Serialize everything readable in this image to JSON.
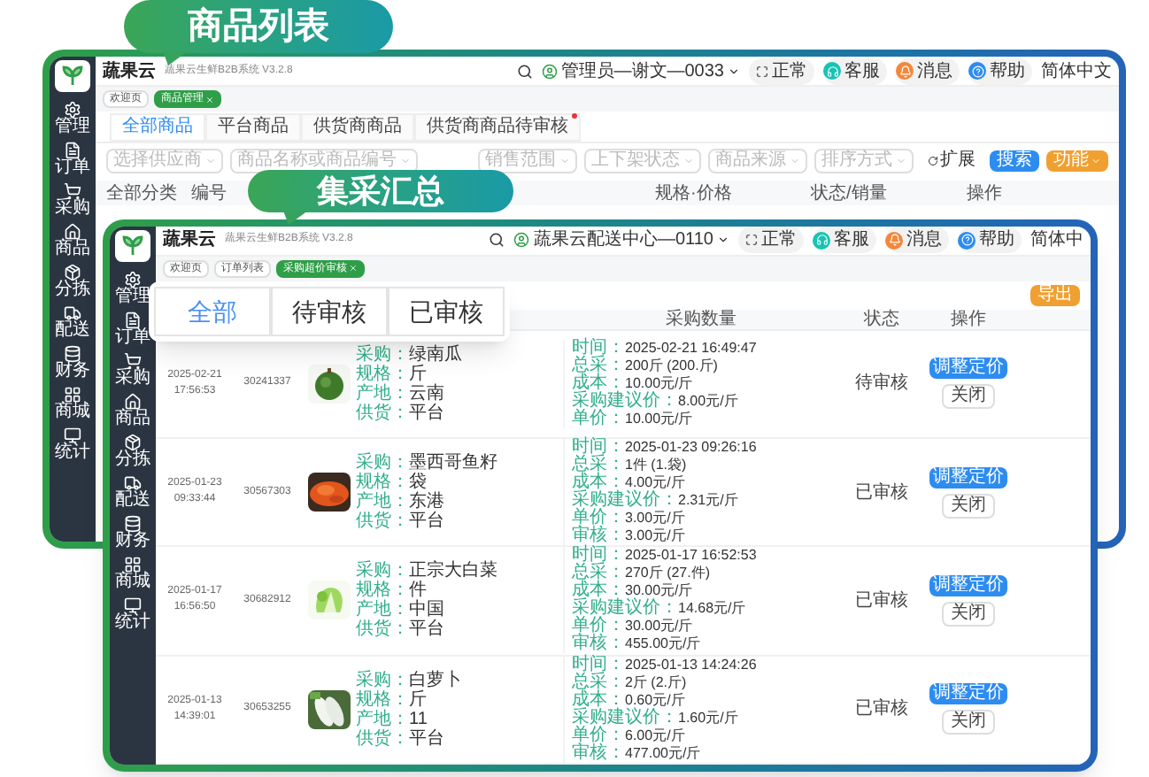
{
  "callouts": [
    {
      "text": "商品列表"
    },
    {
      "text": "集采汇总"
    }
  ],
  "back_window": {
    "title": "蔬果云",
    "subtitle": "蔬果云生鲜B2B系统 V3.2.8",
    "user": "管理员—谢文—0033",
    "status": "正常",
    "actions": [
      {
        "label": "客服",
        "color": "#19c3b4"
      },
      {
        "label": "消息",
        "color": "#f5873a"
      },
      {
        "label": "帮助",
        "color": "#2d8cf0"
      }
    ],
    "language": "简体中文",
    "open_tabs": [
      {
        "label": "欢迎页",
        "selected": false,
        "closable": false
      },
      {
        "label": "商品管理",
        "selected": true,
        "closable": true
      }
    ],
    "sidebar": [
      "管理",
      "订单",
      "采购",
      "商品",
      "分拣",
      "配送",
      "财务",
      "商城",
      "统计"
    ],
    "tabs": [
      {
        "label": "全部商品",
        "selected": true,
        "dot": false
      },
      {
        "label": "平台商品",
        "selected": false,
        "dot": false
      },
      {
        "label": "供货商商品",
        "selected": false,
        "dot": false
      },
      {
        "label": "供货商商品待审核",
        "selected": false,
        "dot": true
      }
    ],
    "filters_left": [
      {
        "placeholder": "选择供应商"
      },
      {
        "placeholder": "商品名称或商品编号"
      }
    ],
    "filters_right": [
      {
        "placeholder": "销售范围"
      },
      {
        "placeholder": "上下架状态"
      },
      {
        "placeholder": "商品来源"
      },
      {
        "placeholder": "排序方式"
      }
    ],
    "toolbar": [
      {
        "label": "扩展",
        "kind": "link"
      },
      {
        "label": "搜索",
        "kind": "primary"
      },
      {
        "label": "功能",
        "kind": "menu"
      }
    ],
    "columns_left": [
      "全部分类",
      "编号"
    ],
    "columns_right": [
      "规格·价格",
      "状态/销量",
      "操作"
    ]
  },
  "front_window": {
    "title": "蔬果云",
    "subtitle": "蔬果云生鲜B2B系统 V3.2.8",
    "user": "蔬果云配送中心—0110",
    "status": "正常",
    "actions": [
      {
        "label": "客服",
        "color": "#19c3b4"
      },
      {
        "label": "消息",
        "color": "#f5873a"
      },
      {
        "label": "帮助",
        "color": "#2d8cf0"
      }
    ],
    "language": "简体中",
    "open_tabs": [
      {
        "label": "欢迎页",
        "selected": false,
        "closable": false
      },
      {
        "label": "订单列表",
        "selected": false,
        "closable": false
      },
      {
        "label": "采购超价审核",
        "selected": true,
        "closable": true
      }
    ],
    "sidebar": [
      "管理",
      "订单",
      "采购",
      "商品",
      "分拣",
      "配送",
      "财务",
      "商城",
      "统计"
    ],
    "filter_tabs": [
      {
        "label": "全部",
        "selected": true
      },
      {
        "label": "待审核",
        "selected": false
      },
      {
        "label": "已审核",
        "selected": false
      }
    ],
    "export_button": "导出",
    "columns": [
      "采购数量",
      "状态",
      "操作"
    ],
    "rows": [
      {
        "date": "2025-02-21",
        "time": "17:56:53",
        "code": "30241337",
        "product": [
          {
            "label": "采购：",
            "value": "绿南瓜"
          },
          {
            "label": "规格：",
            "value": "斤"
          },
          {
            "label": "产地：",
            "value": "云南"
          },
          {
            "label": "供货：",
            "value": "平台"
          }
        ],
        "details": [
          {
            "label": "时间：",
            "value": "2025-02-21 16:49:47"
          },
          {
            "label": "总采：",
            "value": "200斤 (200.斤)"
          },
          {
            "label": "成本：",
            "value": "10.00元/斤"
          },
          {
            "label": "采购建议价：",
            "value": "8.00元/斤"
          },
          {
            "label": "单价：",
            "value": "10.00元/斤"
          }
        ],
        "status": "待审核",
        "buttons": [
          "调整定价",
          "关闭"
        ]
      },
      {
        "date": "2025-01-23",
        "time": "09:33:44",
        "code": "30567303",
        "product": [
          {
            "label": "采购：",
            "value": "墨西哥鱼籽"
          },
          {
            "label": "规格：",
            "value": "袋"
          },
          {
            "label": "产地：",
            "value": "东港"
          },
          {
            "label": "供货：",
            "value": "平台"
          }
        ],
        "details": [
          {
            "label": "时间：",
            "value": "2025-01-23 09:26:16"
          },
          {
            "label": "总采：",
            "value": "1件 (1.袋)"
          },
          {
            "label": "成本：",
            "value": "4.00元/斤"
          },
          {
            "label": "采购建议价：",
            "value": "2.31元/斤"
          },
          {
            "label": "单价：",
            "value": "3.00元/斤"
          },
          {
            "label": "审核：",
            "value": "3.00元/斤"
          }
        ],
        "status": "已审核",
        "buttons": [
          "调整定价",
          "关闭"
        ]
      },
      {
        "date": "2025-01-17",
        "time": "16:56:50",
        "code": "30682912",
        "product": [
          {
            "label": "采购：",
            "value": "正宗大白菜"
          },
          {
            "label": "规格：",
            "value": "件"
          },
          {
            "label": "产地：",
            "value": "中国"
          },
          {
            "label": "供货：",
            "value": "平台"
          }
        ],
        "details": [
          {
            "label": "时间：",
            "value": "2025-01-17 16:52:53"
          },
          {
            "label": "总采：",
            "value": "270斤 (27.件)"
          },
          {
            "label": "成本：",
            "value": "30.00元/斤"
          },
          {
            "label": "采购建议价：",
            "value": "14.68元/斤"
          },
          {
            "label": "单价：",
            "value": "30.00元/斤"
          },
          {
            "label": "审核：",
            "value": "455.00元/斤"
          }
        ],
        "status": "已审核",
        "buttons": [
          "调整定价",
          "关闭"
        ]
      },
      {
        "date": "2025-01-13",
        "time": "14:39:01",
        "code": "30653255",
        "product": [
          {
            "label": "采购：",
            "value": "白萝卜"
          },
          {
            "label": "规格：",
            "value": "斤"
          },
          {
            "label": "产地：",
            "value": "11"
          },
          {
            "label": "供货：",
            "value": "平台"
          }
        ],
        "details": [
          {
            "label": "时间：",
            "value": "2025-01-13 14:24:26"
          },
          {
            "label": "总采：",
            "value": "2斤 (2.斤)"
          },
          {
            "label": "成本：",
            "value": "0.60元/斤"
          },
          {
            "label": "采购建议价：",
            "value": "1.60元/斤"
          },
          {
            "label": "单价：",
            "value": "6.00元/斤"
          },
          {
            "label": "审核：",
            "value": "477.00元/斤"
          }
        ],
        "status": "已审核",
        "buttons": [
          "调整定价",
          "关闭"
        ]
      }
    ]
  }
}
